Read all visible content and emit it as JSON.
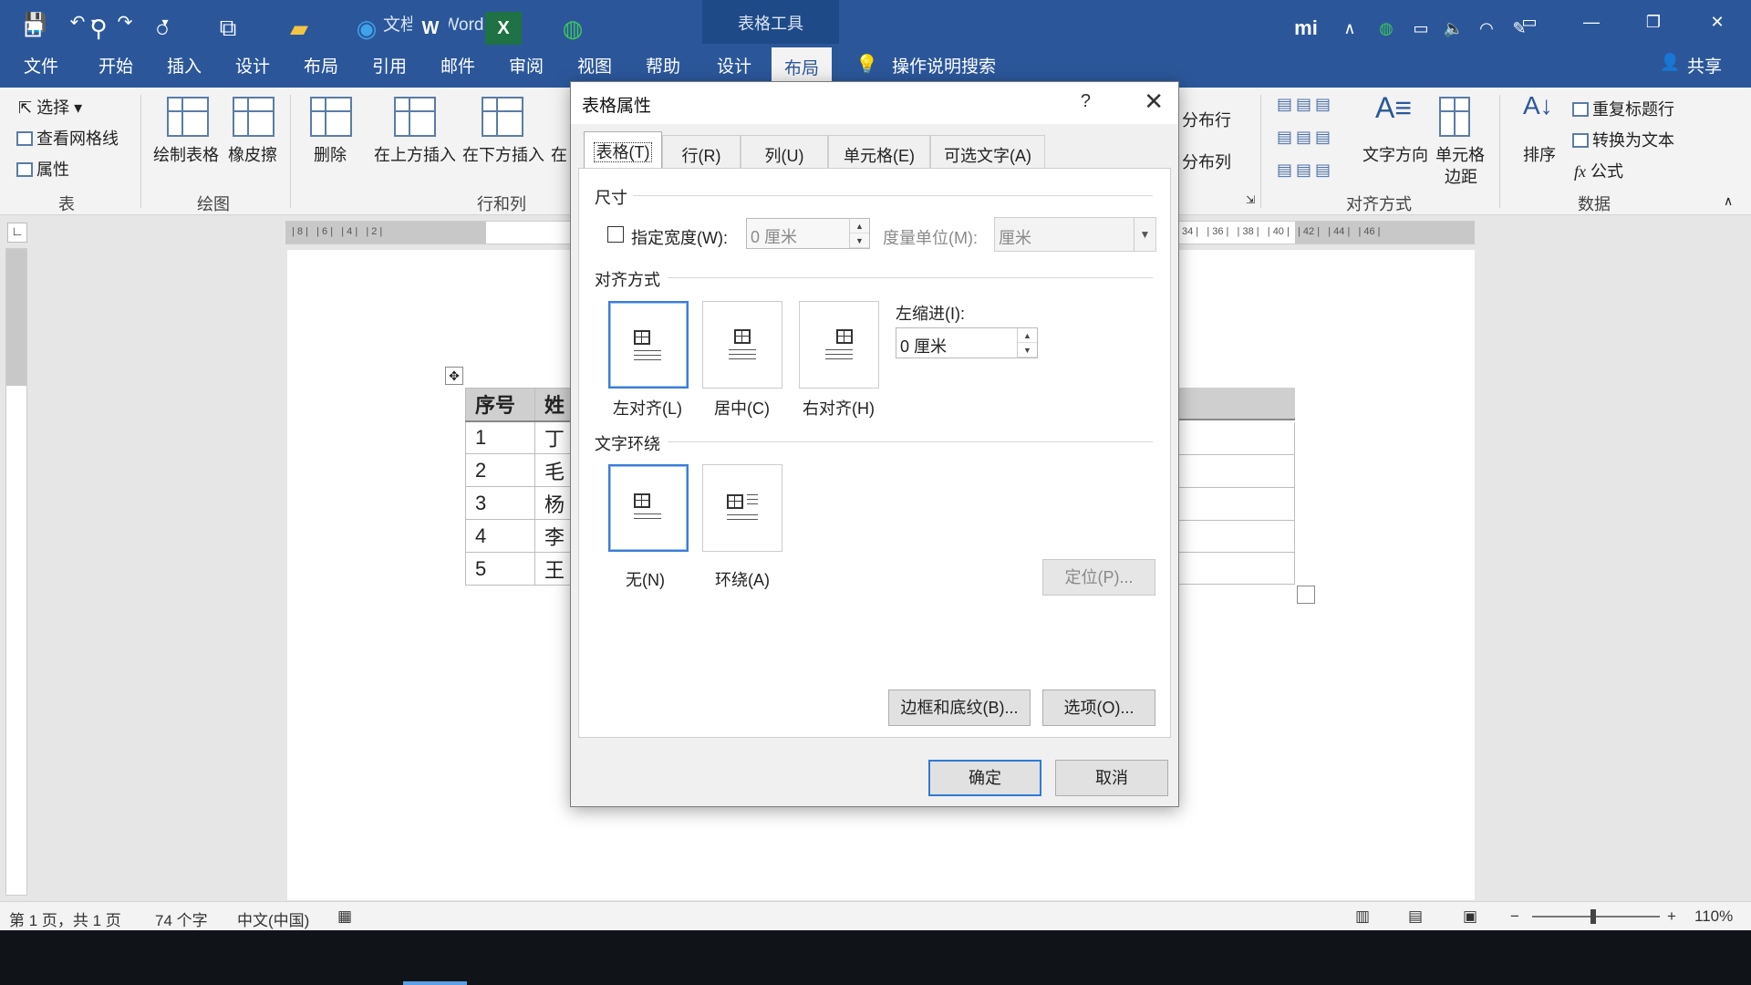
{
  "titlebar": {
    "doc_title": "文档1 - Word",
    "context_tools": "表格工具",
    "share": "共享"
  },
  "tabs": [
    "文件",
    "开始",
    "插入",
    "设计",
    "布局",
    "引用",
    "邮件",
    "审阅",
    "视图",
    "帮助",
    "设计",
    "布局"
  ],
  "tell_me": "操作说明搜索",
  "ribbon": {
    "select": "选择",
    "view_gridlines": "查看网格线",
    "properties": "属性",
    "group_table": "表",
    "draw_table": "绘制表格",
    "eraser": "橡皮擦",
    "group_draw": "绘图",
    "delete": "删除",
    "insert_above": "在上方插入",
    "insert_below": "在下方插入",
    "insert_left_partial": "在",
    "group_rows_cols": "行和列",
    "distribute_rows": "分布行",
    "distribute_cols": "分布列",
    "text_direction": "文字方向",
    "cell_margins_1": "单元格",
    "cell_margins_2": "边距",
    "group_alignment": "对齐方式",
    "sort": "排序",
    "repeat_header": "重复标题行",
    "convert_text": "转换为文本",
    "formula": "公式",
    "group_data": "数据"
  },
  "ruler": {
    "left": "| 8 |   | 6 |   | 4 |   | 2 |",
    "right": "34 |   | 36 |   | 38 |   | 40 |   | 42 |   | 44 |   | 46 |"
  },
  "doc_table": {
    "headers": [
      "序号",
      "姓"
    ],
    "rows": [
      [
        "1",
        "丁"
      ],
      [
        "2",
        "毛"
      ],
      [
        "3",
        "杨"
      ],
      [
        "4",
        "李"
      ],
      [
        "5",
        "王"
      ]
    ]
  },
  "dialog": {
    "title": "表格属性",
    "help": "?",
    "tabs": [
      "表格(T)",
      "行(R)",
      "列(U)",
      "单元格(E)",
      "可选文字(A)"
    ],
    "size_section": "尺寸",
    "preferred_width": "指定宽度(W):",
    "width_value": "0 厘米",
    "measure_in": "度量单位(M):",
    "measure_value": "厘米",
    "alignment_section": "对齐方式",
    "align_left": "左对齐(L)",
    "align_center": "居中(C)",
    "align_right": "右对齐(H)",
    "indent_left": "左缩进(I):",
    "indent_value": "0 厘米",
    "wrapping_section": "文字环绕",
    "wrap_none": "无(N)",
    "wrap_around": "环绕(A)",
    "positioning": "定位(P)...",
    "borders_shading": "边框和底纹(B)...",
    "options": "选项(O)...",
    "ok": "确定",
    "cancel": "取消"
  },
  "status": {
    "page": "第 1 页，共 1 页",
    "words": "74 个字",
    "lang": "中文(中国)",
    "zoom": "110%"
  },
  "colors": {
    "word_blue": "#2b579a",
    "ribbon_bg": "#f3f3f3",
    "taskbar": "#101318"
  }
}
